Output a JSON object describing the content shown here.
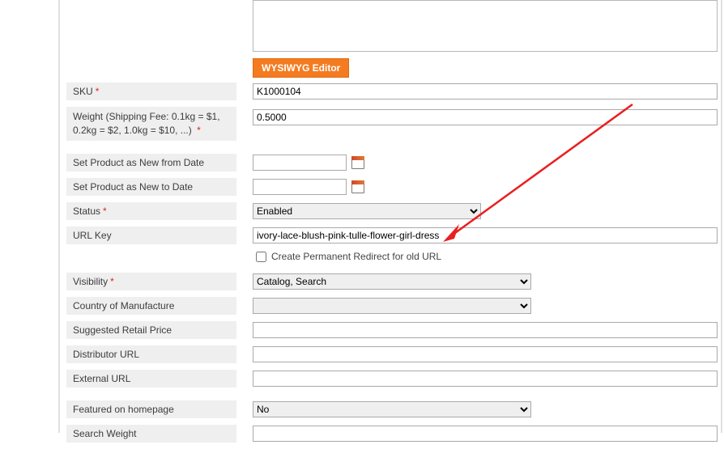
{
  "buttons": {
    "wysiwyg": "WYSIWYG Editor"
  },
  "fields": {
    "sku": {
      "label": "SKU",
      "required": true,
      "value": "K1000104"
    },
    "weight": {
      "label": "Weight (Shipping Fee: 0.1kg = $1, 0.2kg = $2, 1.0kg = $10, ...)",
      "required": true,
      "value": "0.5000"
    },
    "new_from": {
      "label": "Set Product as New from Date",
      "value": ""
    },
    "new_to": {
      "label": "Set Product as New to Date",
      "value": ""
    },
    "status": {
      "label": "Status",
      "required": true,
      "selected": "Enabled"
    },
    "url_key": {
      "label": "URL Key",
      "value": "ivory-lace-blush-pink-tulle-flower-girl-dress"
    },
    "url_redirect": {
      "label": "Create Permanent Redirect for old URL"
    },
    "visibility": {
      "label": "Visibility",
      "required": true,
      "selected": "Catalog, Search"
    },
    "country": {
      "label": "Country of Manufacture",
      "selected": ""
    },
    "suggested_price": {
      "label": "Suggested Retail Price",
      "value": ""
    },
    "distributor_url": {
      "label": "Distributor URL",
      "value": ""
    },
    "external_url": {
      "label": "External URL",
      "value": ""
    },
    "featured": {
      "label": "Featured on homepage",
      "selected": "No"
    },
    "search_weight": {
      "label": "Search Weight",
      "value": ""
    }
  }
}
